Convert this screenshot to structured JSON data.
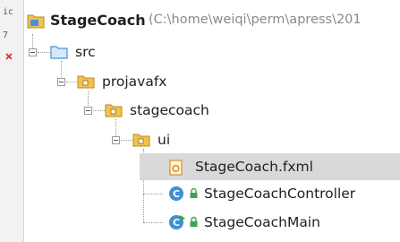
{
  "tree": {
    "root": {
      "label": "StageCoach",
      "path": "(C:\\home\\weiqi\\perm\\apress\\201"
    },
    "src": {
      "label": "src"
    },
    "projavafx": {
      "label": "projavafx"
    },
    "stagecoach": {
      "label": "stagecoach"
    },
    "ui": {
      "label": "ui"
    },
    "files": [
      {
        "label": "StageCoach.fxml",
        "icon": "fxml-file-icon",
        "selected": true
      },
      {
        "label": "StageCoachController",
        "icon": "class-icon"
      },
      {
        "label": "StageCoachMain",
        "icon": "runnable-class-icon"
      }
    ]
  },
  "colors": {
    "selection": "#d9d9d9",
    "folder": "#e8b04a",
    "source_folder": "#4a90d9",
    "class_icon": "#3d8fd6",
    "lock": "#3fa34d"
  },
  "gutter": {
    "glyphs": [
      "ic",
      "7"
    ]
  }
}
